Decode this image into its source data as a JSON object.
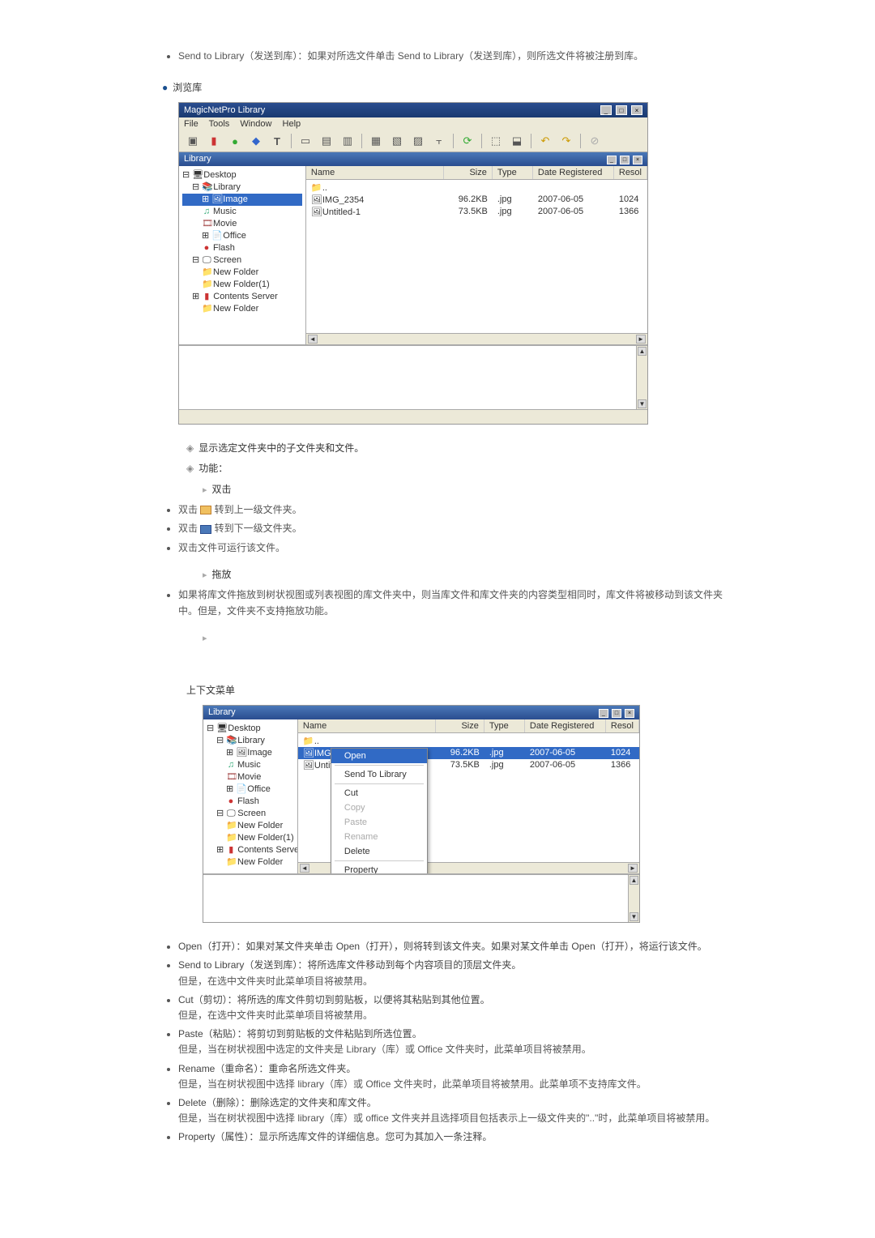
{
  "intro": {
    "send_to_library": "Send to Library（发送到库）：如果对所选文件单击 Send to Library（发送到库），则所选文件将被注册到库。"
  },
  "browse_heading": "浏览库",
  "window1": {
    "title": "MagicNetPro Library",
    "menus": [
      "File",
      "Tools",
      "Window",
      "Help"
    ],
    "panel_title": "Library",
    "tree": {
      "root": "Desktop",
      "n1": "Library",
      "n2_sel": "Image",
      "n3": "Music",
      "n4": "Movie",
      "n5": "Office",
      "n6": "Flash",
      "n7": "Screen",
      "n8": "New Folder",
      "n9": "New Folder(1)",
      "n10": "Contents Server",
      "n11": "New Folder"
    },
    "cols": {
      "name": "Name",
      "size": "Size",
      "type": "Type",
      "date": "Date Registered",
      "res": "Resol"
    },
    "rows": [
      {
        "name": "..",
        "size": "",
        "type": "",
        "date": "",
        "res": ""
      },
      {
        "name": "IMG_2354",
        "size": "96.2KB",
        "type": ".jpg",
        "date": "2007-06-05",
        "res": "1024"
      },
      {
        "name": "Untitled-1",
        "size": "73.5KB",
        "type": ".jpg",
        "date": "2007-06-05",
        "res": "1366"
      }
    ]
  },
  "notes": {
    "n1": "显示选定文件夹中的子文件夹和文件。",
    "n2": "功能：",
    "dclick": "双击",
    "dclick_b1_pre": "双击 ",
    "dclick_b1_post": " 转到上一级文件夹。",
    "dclick_b2_pre": "双击 ",
    "dclick_b2_post": " 转到下一级文件夹。",
    "dclick_b3": "双击文件可运行该文件。",
    "drag": "拖放",
    "drag_b1": "如果将库文件拖放到树状视图或列表视图的库文件夹中，则当库文件和库文件夹的内容类型相同时，库文件将被移动到该文件夹中。但是，文件夹不支持拖放功能。"
  },
  "context_heading": "上下文菜单",
  "window2": {
    "panel_title": "Library",
    "menu": {
      "open": "Open",
      "send": "Send To Library",
      "cut": "Cut",
      "copy": "Copy",
      "paste": "Paste",
      "rename": "Rename",
      "delete": "Delete",
      "property": "Property"
    }
  },
  "context_items": {
    "open": "Open（打开）：如果对某文件夹单击 Open（打开），则将转到该文件夹。如果对某文件单击 Open（打开），将运行该文件。",
    "send": "Send to Library（发送到库）：将所选库文件移动到每个内容项目的顶层文件夹。",
    "send_note": "但是，在选中文件夹时此菜单项目将被禁用。",
    "cut": "Cut（剪切）：将所选的库文件剪切到剪贴板，以便将其粘贴到其他位置。",
    "cut_note": "但是，在选中文件夹时此菜单项目将被禁用。",
    "paste": "Paste（粘贴）：将剪切到剪贴板的文件粘贴到所选位置。",
    "paste_note": "但是，当在树状视图中选定的文件夹是 Library（库）或 Office 文件夹时，此菜单项目将被禁用。",
    "rename": "Rename（重命名）：重命名所选文件夹。",
    "rename_note": "但是，当在树状视图中选择 library（库）或 Office 文件夹时，此菜单项目将被禁用。此菜单项不支持库文件。",
    "delete": "Delete（删除）：删除选定的文件夹和库文件。",
    "delete_note": "但是，当在树状视图中选择 library（库）或 office 文件夹并且选择项目包括表示上一级文件夹的\"..\"时，此菜单项目将被禁用。",
    "property": "Property（属性）：显示所选库文件的详细信息。您可为其加入一条注释。"
  }
}
